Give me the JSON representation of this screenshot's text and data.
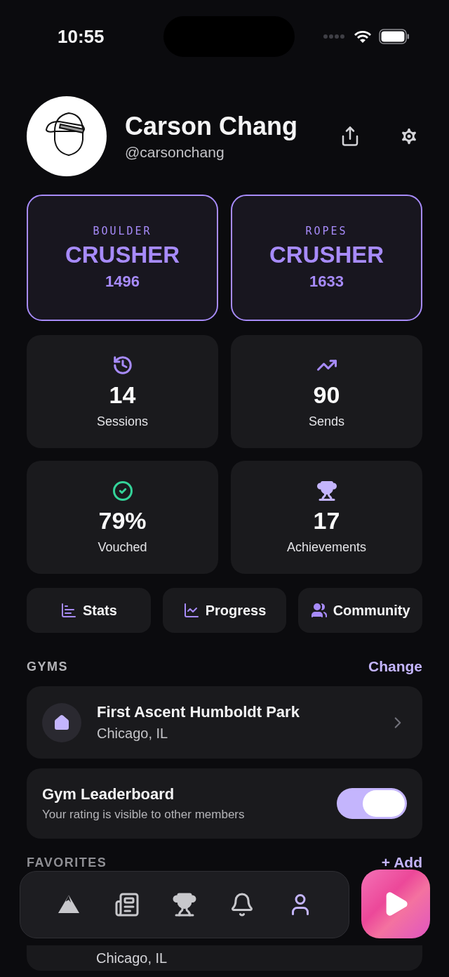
{
  "status_bar": {
    "time": "10:55"
  },
  "profile": {
    "name": "Carson Chang",
    "handle": "@carsonchang"
  },
  "ratings": [
    {
      "discipline": "BOULDER",
      "rank": "CRUSHER",
      "score": "1496"
    },
    {
      "discipline": "ROPES",
      "rank": "CRUSHER",
      "score": "1633"
    }
  ],
  "stats": [
    {
      "kind": "sessions",
      "value": "14",
      "label": "Sessions",
      "color": "#a78bfa"
    },
    {
      "kind": "sends",
      "value": "90",
      "label": "Sends",
      "color": "#a78bfa"
    },
    {
      "kind": "vouched",
      "value": "79%",
      "label": "Vouched",
      "color": "#34d399"
    },
    {
      "kind": "achievements",
      "value": "17",
      "label": "Achievements",
      "color": "#c4b5fd"
    }
  ],
  "quick_links": [
    {
      "kind": "stats",
      "label": "Stats"
    },
    {
      "kind": "progress",
      "label": "Progress"
    },
    {
      "kind": "community",
      "label": "Community"
    }
  ],
  "gyms": {
    "title": "GYMS",
    "action": "Change",
    "home": {
      "name": "First Ascent Humboldt Park",
      "location": "Chicago, IL"
    }
  },
  "leaderboard": {
    "title": "Gym Leaderboard",
    "description": "Your rating is visible to other members",
    "on": true
  },
  "favorites": {
    "title": "FAVORITES",
    "action": "+ Add",
    "items": [
      {
        "location": "Chicago, IL"
      }
    ]
  },
  "tab_bar": [
    {
      "kind": "climb",
      "selected": false
    },
    {
      "kind": "news",
      "selected": false
    },
    {
      "kind": "trophy",
      "selected": false
    },
    {
      "kind": "alerts",
      "selected": false
    },
    {
      "kind": "profile",
      "selected": true
    }
  ]
}
